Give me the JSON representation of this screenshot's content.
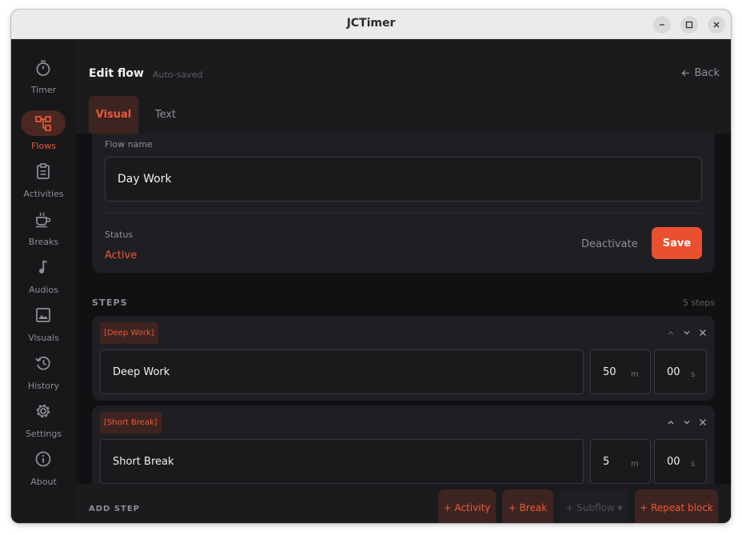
{
  "window": {
    "title": "JCTimer"
  },
  "sidebar": {
    "items": [
      {
        "label": "Timer",
        "icon": "stopwatch-icon",
        "active": false
      },
      {
        "label": "Flows",
        "icon": "flows-icon",
        "active": true
      },
      {
        "label": "Activities",
        "icon": "clipboard-icon",
        "active": false
      },
      {
        "label": "Breaks",
        "icon": "coffee-cup-icon",
        "active": false
      },
      {
        "label": "Audios",
        "icon": "music-note-icon",
        "active": false
      },
      {
        "label": "Visuals",
        "icon": "image-icon",
        "active": false
      },
      {
        "label": "History",
        "icon": "history-icon",
        "active": false
      },
      {
        "label": "Settings",
        "icon": "gear-icon",
        "active": false
      },
      {
        "label": "About",
        "icon": "info-icon",
        "active": false
      }
    ]
  },
  "header": {
    "title": "Edit flow",
    "subtitle": "Auto-saved",
    "back_label": "Back"
  },
  "tabs": [
    {
      "label": "Visual",
      "active": true
    },
    {
      "label": "Text",
      "active": false
    }
  ],
  "form": {
    "flow_name_label": "Flow name",
    "flow_name_value": "Day Work",
    "status_label": "Status",
    "status_value": "Active",
    "deactivate_label": "Deactivate",
    "save_label": "Save"
  },
  "steps": {
    "title": "STEPS",
    "count": "5 steps",
    "items": [
      {
        "tag": "[Deep Work]",
        "name": "Deep Work",
        "minutes": "50",
        "minutes_unit": "m",
        "seconds": "00",
        "seconds_unit": "s"
      },
      {
        "tag": "[Short Break]",
        "name": "Short Break",
        "minutes": "5",
        "minutes_unit": "m",
        "seconds": "00",
        "seconds_unit": "s"
      }
    ]
  },
  "footer": {
    "add_step_label": "ADD STEP",
    "buttons": [
      {
        "label": "+ Activity",
        "disabled": false
      },
      {
        "label": "+ Break",
        "disabled": false
      },
      {
        "label": "+ Subflow ▾",
        "disabled": true
      },
      {
        "label": "+ Repeat block",
        "disabled": false
      }
    ]
  },
  "colors": {
    "accent": "#e85a3a",
    "save": "#ea4f30",
    "background": "#18181b",
    "card": "#1f1f23"
  }
}
